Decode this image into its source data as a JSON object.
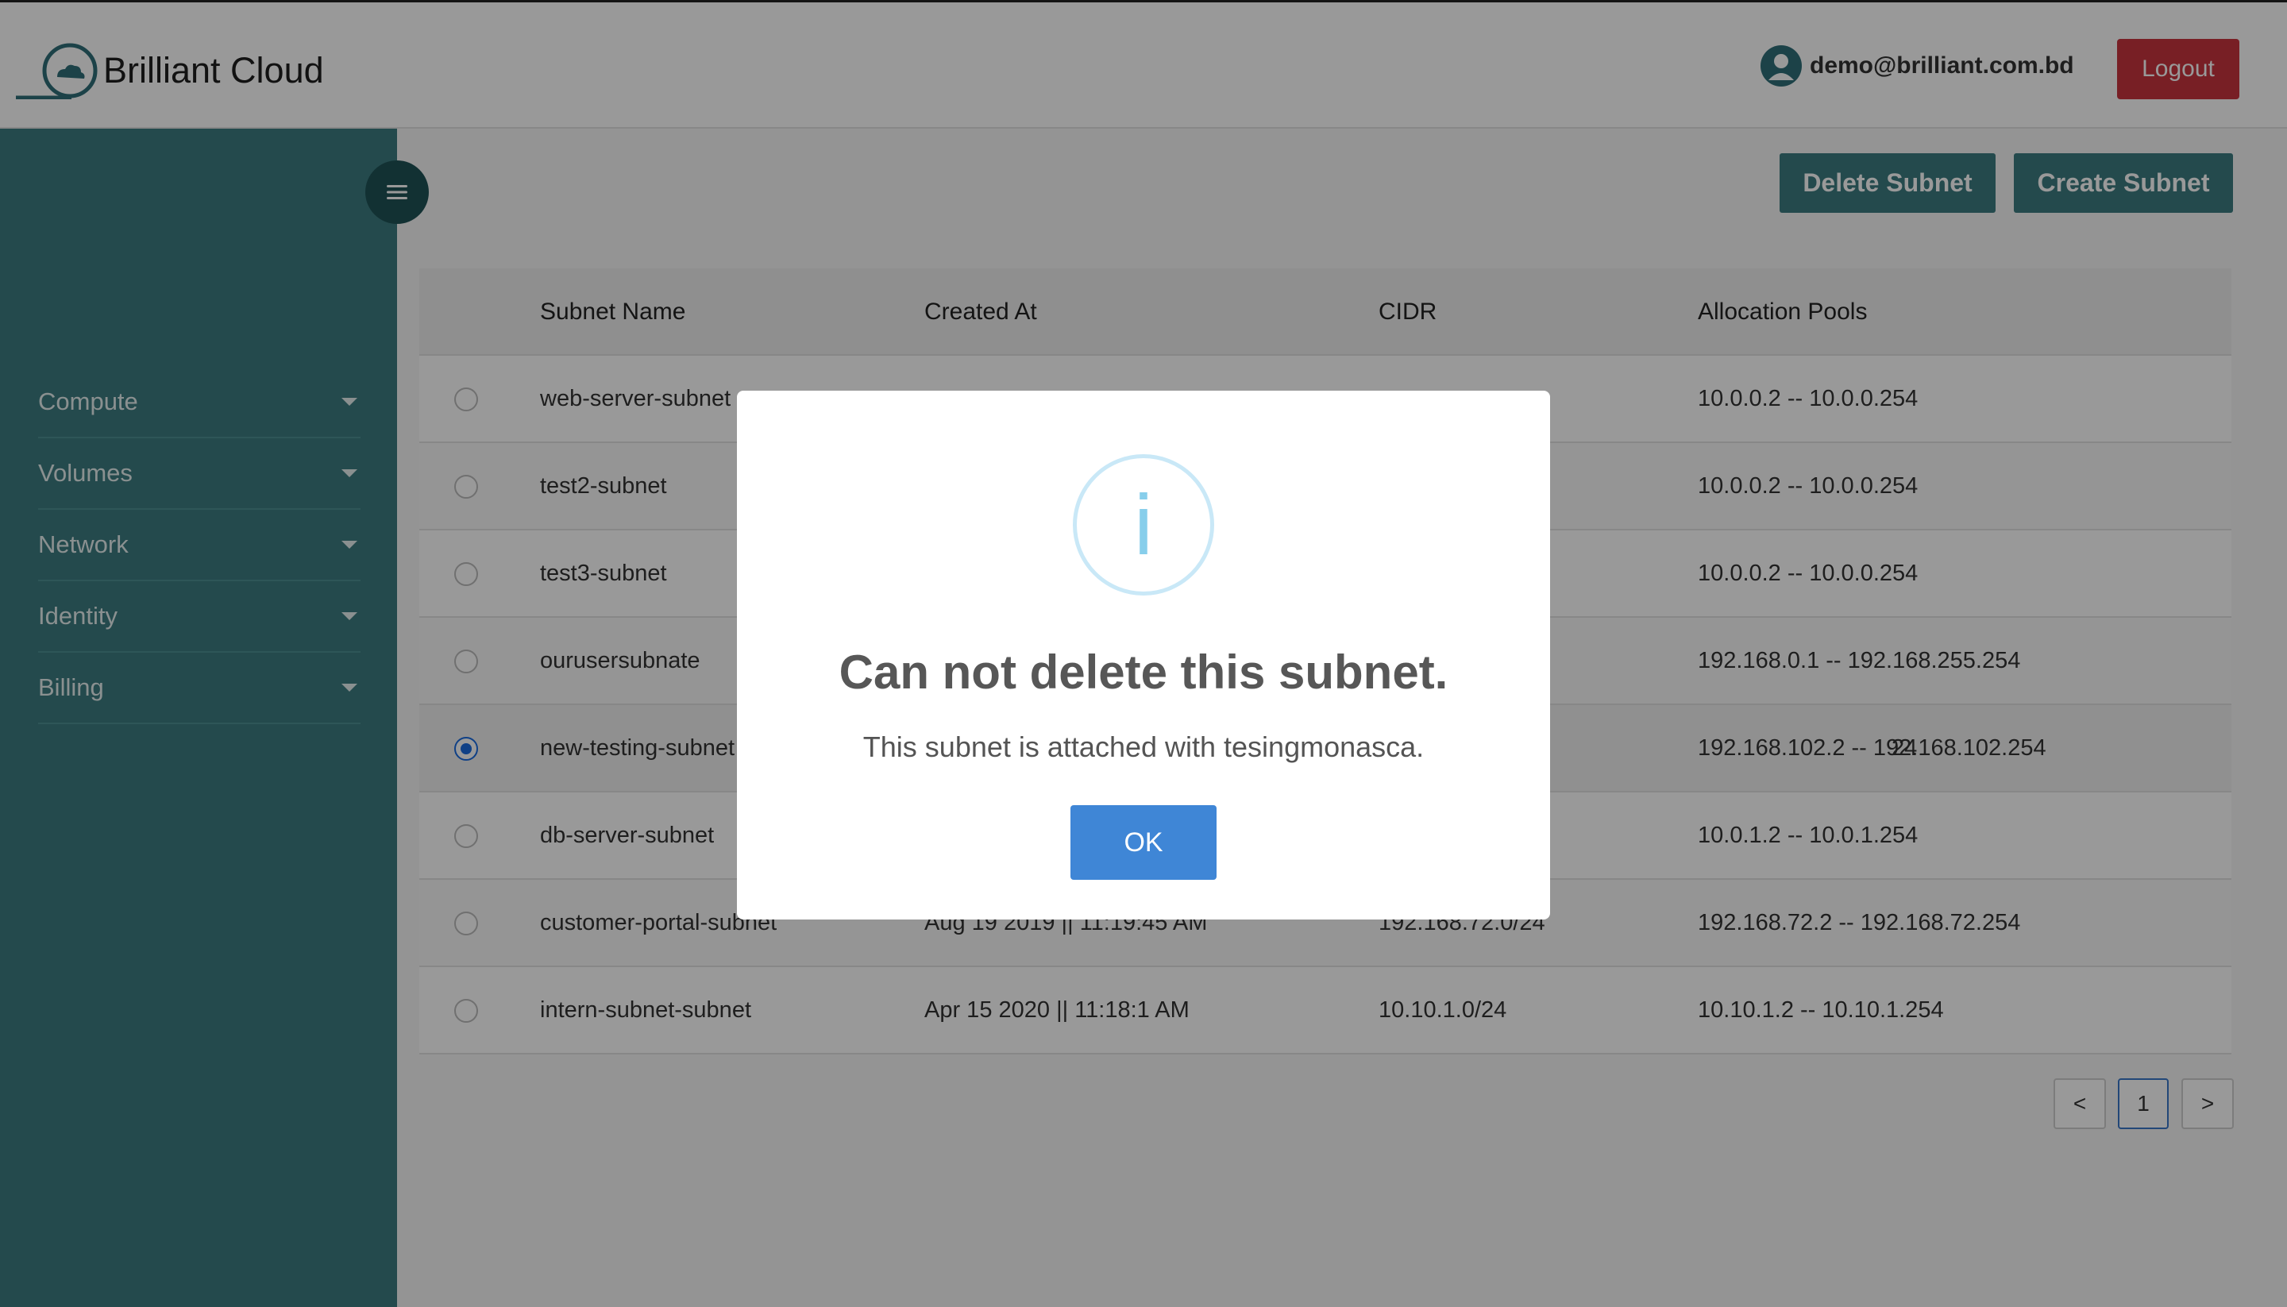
{
  "header": {
    "brand": "Brilliant Cloud",
    "user_email": "demo@brilliant.com.bd",
    "logout_label": "Logout"
  },
  "sidebar": {
    "items": [
      {
        "label": "Compute"
      },
      {
        "label": "Volumes"
      },
      {
        "label": "Network"
      },
      {
        "label": "Identity"
      },
      {
        "label": "Billing"
      }
    ]
  },
  "toolbar": {
    "delete_label": "Delete Subnet",
    "create_label": "Create Subnet"
  },
  "table": {
    "columns": [
      "Subnet Name",
      "Created At",
      "CIDR",
      "Allocation Pools"
    ],
    "rows": [
      {
        "name": "web-server-subnet",
        "created": "",
        "cidr": "",
        "pools": "10.0.0.2 -- 10.0.0.254",
        "selected": false
      },
      {
        "name": "test2-subnet",
        "created": "",
        "cidr": "",
        "pools": "10.0.0.2 -- 10.0.0.254",
        "selected": false
      },
      {
        "name": "test3-subnet",
        "created": "",
        "cidr": "",
        "pools": "10.0.0.2 -- 10.0.0.254",
        "selected": false
      },
      {
        "name": "ourusersubnate",
        "created": "",
        "cidr": "",
        "pools": "192.168.0.1 -- 192.168.255.254",
        "selected": false
      },
      {
        "name": "new-testing-subnet",
        "created": "",
        "cidr": "24",
        "pools": "192.168.102.2 -- 192.168.102.254",
        "selected": true
      },
      {
        "name": "db-server-subnet",
        "created": "",
        "cidr": "",
        "pools": "10.0.1.2 -- 10.0.1.254",
        "selected": false
      },
      {
        "name": "customer-portal-subnet",
        "created": "Aug 19 2019 || 11:19:45 AM",
        "cidr": "192.168.72.0/24",
        "pools": "192.168.72.2 -- 192.168.72.254",
        "selected": false
      },
      {
        "name": "intern-subnet-subnet",
        "created": "Apr 15 2020 || 11:18:1 AM",
        "cidr": "10.10.1.0/24",
        "pools": "10.10.1.2 -- 10.10.1.254",
        "selected": false
      }
    ]
  },
  "pagination": {
    "prev": "<",
    "current": "1",
    "next": ">"
  },
  "modal": {
    "icon": "i",
    "title": "Can not delete this subnet.",
    "text": "This subnet is attached with tesingmonasca.",
    "ok_label": "OK"
  },
  "colors": {
    "sidebar": "#3c7c80",
    "logout": "#c9343f",
    "ok_button": "#3f86d6",
    "info_icon": "#87ceeb"
  }
}
